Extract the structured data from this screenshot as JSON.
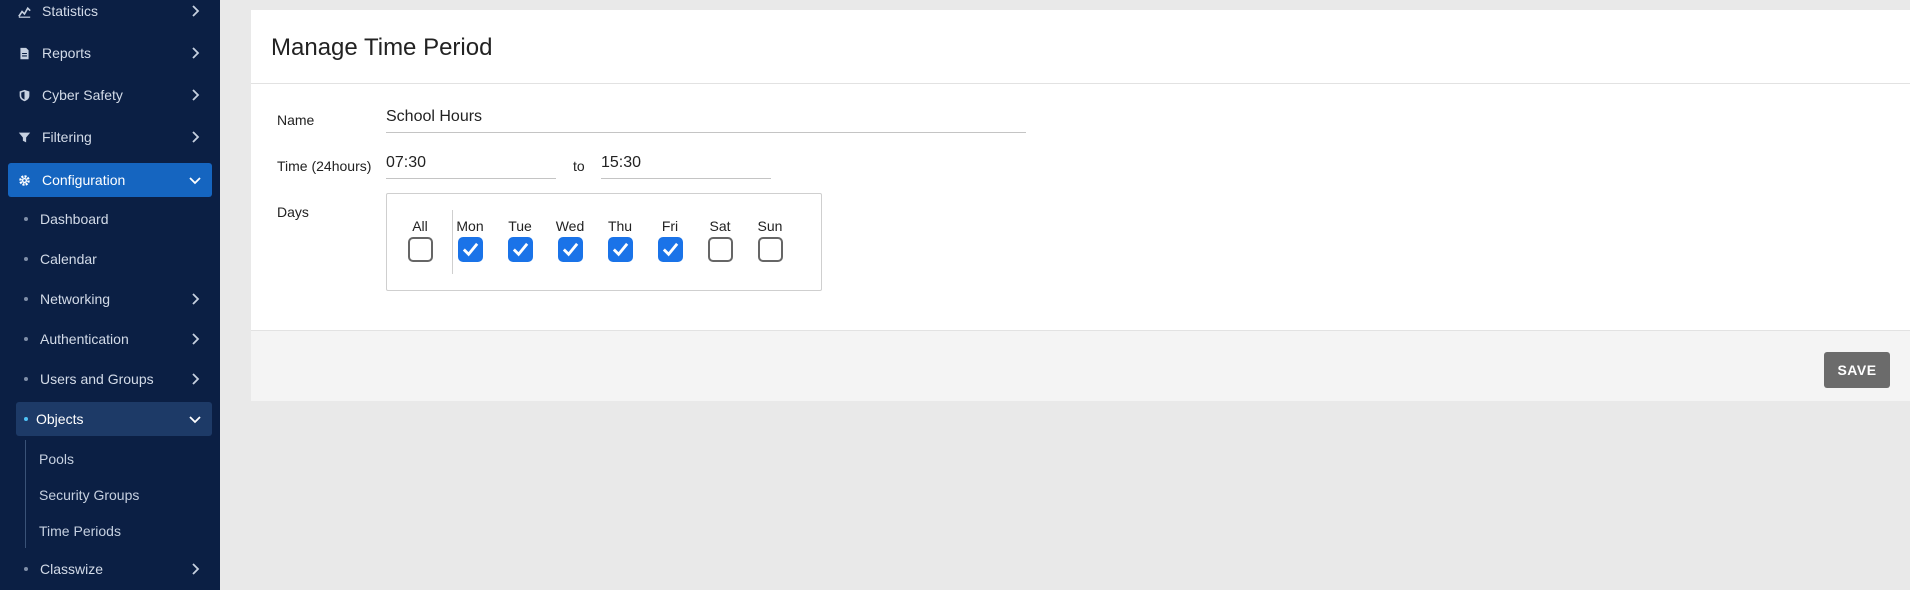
{
  "sidebar": {
    "items": [
      {
        "label": "Statistics",
        "icon": "chart-icon"
      },
      {
        "label": "Reports",
        "icon": "document-icon"
      },
      {
        "label": "Cyber Safety",
        "icon": "shield-icon"
      },
      {
        "label": "Filtering",
        "icon": "filter-icon"
      },
      {
        "label": "Configuration",
        "icon": "gear-icon"
      },
      {
        "label": "Dashboard"
      },
      {
        "label": "Calendar"
      },
      {
        "label": "Networking"
      },
      {
        "label": "Authentication"
      },
      {
        "label": "Users and Groups"
      },
      {
        "label": "Objects"
      },
      {
        "label": "Classwize"
      }
    ],
    "sub_items": [
      {
        "label": "Pools"
      },
      {
        "label": "Security Groups"
      },
      {
        "label": "Time Periods"
      }
    ]
  },
  "main": {
    "title": "Manage Time Period",
    "name_label": "Name",
    "name_value": "School Hours",
    "time_label": "Time (24hours)",
    "time_from": "07:30",
    "time_to_label": "to",
    "time_to": "15:30",
    "days_label": "Days",
    "days": [
      {
        "label": "All",
        "checked": false
      },
      {
        "label": "Mon",
        "checked": true
      },
      {
        "label": "Tue",
        "checked": true
      },
      {
        "label": "Wed",
        "checked": true
      },
      {
        "label": "Thu",
        "checked": true
      },
      {
        "label": "Fri",
        "checked": true
      },
      {
        "label": "Sat",
        "checked": false
      },
      {
        "label": "Sun",
        "checked": false
      }
    ],
    "save_label": "SAVE"
  },
  "colors": {
    "sidebar_bg": "#0b1f44",
    "active_bg": "#1565c0",
    "checkbox_checked": "#1a73e8",
    "save_button": "#6b6b6b"
  }
}
